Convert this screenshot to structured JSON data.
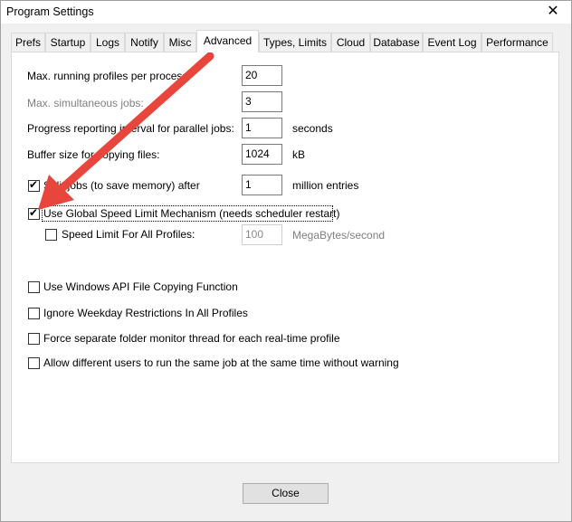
{
  "window": {
    "title": "Program Settings",
    "close_glyph": "✕"
  },
  "tabs": [
    {
      "label": "Prefs"
    },
    {
      "label": "Startup"
    },
    {
      "label": "Logs"
    },
    {
      "label": "Notify"
    },
    {
      "label": "Misc"
    },
    {
      "label": "Advanced"
    },
    {
      "label": "Types, Limits"
    },
    {
      "label": "Cloud"
    },
    {
      "label": "Database"
    },
    {
      "label": "Event Log"
    },
    {
      "label": "Performance"
    }
  ],
  "active_tab": "Advanced",
  "settings": {
    "max_profiles": {
      "label": "Max. running profiles per process:",
      "value": "20"
    },
    "max_jobs": {
      "label": "Max. simultaneous jobs:",
      "value": "3"
    },
    "progress_interval": {
      "label": "Progress reporting interval for parallel jobs:",
      "value": "1",
      "unit": "seconds"
    },
    "buffer_size": {
      "label": "Buffer size for copying files:",
      "value": "1024",
      "unit": "kB"
    },
    "split_jobs": {
      "label": "Split jobs (to save memory) after",
      "checked": true,
      "value": "1",
      "unit": "million entries"
    },
    "global_speed": {
      "label": "Use Global Speed Limit Mechanism (needs scheduler restart)",
      "checked": true
    },
    "speed_limit": {
      "label": "Speed Limit For All Profiles:",
      "checked": false,
      "value": "100",
      "unit": "MegaBytes/second"
    },
    "win_api": {
      "label": "Use Windows API File Copying Function",
      "checked": false
    },
    "ignore_weekday": {
      "label": "Ignore Weekday Restrictions In All Profiles",
      "checked": false
    },
    "force_monitor": {
      "label": "Force separate folder monitor thread for each real-time profile",
      "checked": false
    },
    "allow_users": {
      "label": "Allow different users to run the same job at the same time without warning",
      "checked": false
    }
  },
  "footer": {
    "close_label": "Close"
  },
  "colors": {
    "annotation_arrow": "#e8463c"
  }
}
